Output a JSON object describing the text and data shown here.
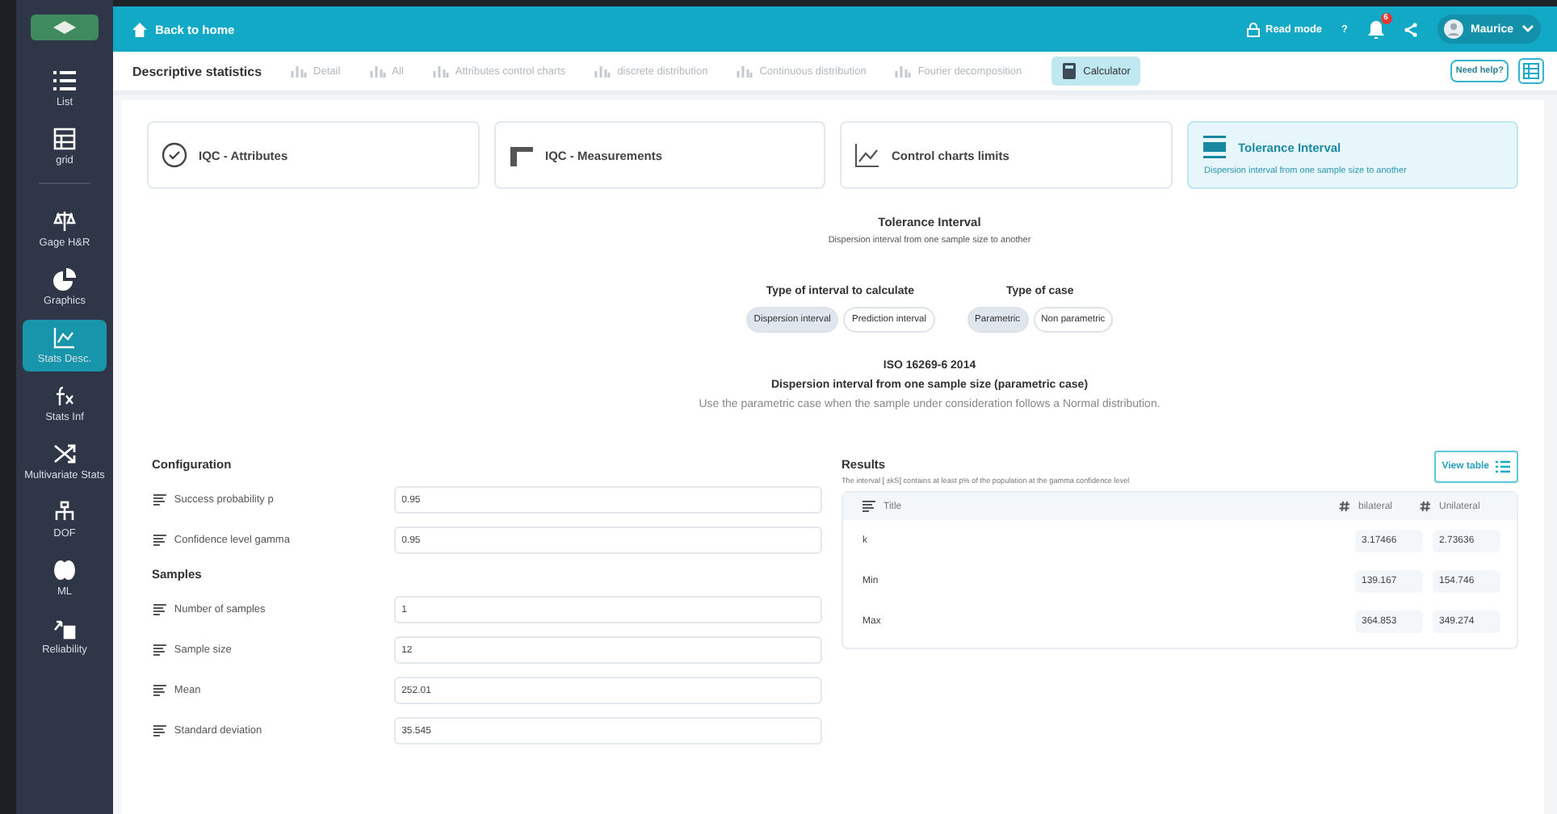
{
  "sidebar": {
    "items": [
      {
        "label": "List",
        "selected": false
      },
      {
        "label": "grid",
        "selected": false
      },
      {
        "label": "Gage H&R",
        "selected": false
      },
      {
        "label": "Graphics",
        "selected": false
      },
      {
        "label": "Stats Desc.",
        "selected": true
      },
      {
        "label": "Stats Inf",
        "selected": false
      },
      {
        "label": "Multivariate Stats",
        "selected": false
      },
      {
        "label": "DOF",
        "selected": false
      },
      {
        "label": "ML",
        "selected": false
      },
      {
        "label": "Reliability",
        "selected": false
      }
    ]
  },
  "topbar": {
    "back": "Back to home",
    "read_mode": "Read mode",
    "help": "?",
    "notifications": "6",
    "user": "Maurice"
  },
  "nav": {
    "title": "Descriptive statistics",
    "tabs": [
      {
        "label": "Detail",
        "selected": false
      },
      {
        "label": "All",
        "selected": false
      },
      {
        "label": "Attributes control charts",
        "selected": false
      },
      {
        "label": "discrete distribution",
        "selected": false
      },
      {
        "label": "Continuous distribution",
        "selected": false
      },
      {
        "label": "Fourier decomposition",
        "selected": false
      },
      {
        "label": "Calculator",
        "selected": true
      }
    ],
    "help": "Need help?"
  },
  "cards": [
    {
      "title": "IQC - Attributes",
      "selected": false
    },
    {
      "title": "IQC - Measurements",
      "selected": false
    },
    {
      "title": "Control charts limits",
      "selected": false
    },
    {
      "title": "Tolerance Interval",
      "subtitle": "Dispersion interval from one sample size to another",
      "selected": true
    }
  ],
  "calculator": {
    "title": "Tolerance Interval",
    "subtitle": "Dispersion interval from one sample size to another",
    "groups": [
      {
        "label": "Type of interval to calculate",
        "options": [
          {
            "label": "Dispersion interval",
            "selected": true
          },
          {
            "label": "Prediction interval",
            "selected": false
          }
        ]
      },
      {
        "label": "Type of case",
        "options": [
          {
            "label": "Parametric",
            "selected": true
          },
          {
            "label": "Non parametric",
            "selected": false
          }
        ]
      }
    ],
    "standard": "ISO 16269-6 2014",
    "method": "Dispersion interval from one sample size (parametric case)",
    "note": "Use the parametric case when the sample under consideration follows a Normal distribution."
  },
  "configuration": {
    "title": "Configuration",
    "fields": [
      {
        "label": "Success probability p",
        "value": "0.95"
      },
      {
        "label": "Confidence level gamma",
        "value": "0.95"
      }
    ]
  },
  "samples": {
    "title": "Samples",
    "fields": [
      {
        "label": "Number of samples",
        "value": "1"
      },
      {
        "label": "Sample size",
        "value": "12"
      },
      {
        "label": "Mean",
        "value": "252.01"
      },
      {
        "label": "Standard deviation",
        "value": "35.545"
      }
    ]
  },
  "results": {
    "title": "Results",
    "subtitle": "The interval [ ±kS] contains at least p% of the population at the gamma confidence level",
    "view_table": "View table",
    "columns": [
      "Title",
      "bilateral",
      "Unilateral"
    ],
    "rows": [
      {
        "title": "k",
        "bilateral": "3.17466",
        "unilateral": "2.73636"
      },
      {
        "title": "Min",
        "bilateral": "139.167",
        "unilateral": "154.746"
      },
      {
        "title": "Max",
        "bilateral": "364.853",
        "unilateral": "349.274"
      }
    ]
  }
}
